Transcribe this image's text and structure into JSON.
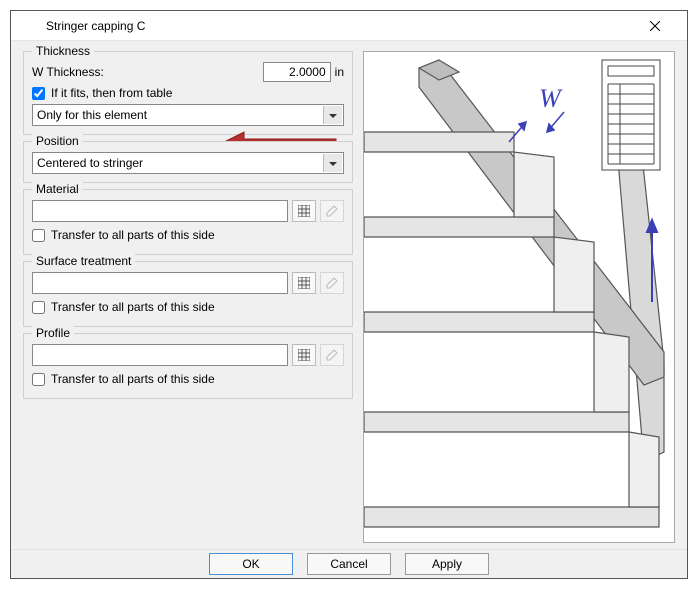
{
  "window": {
    "title": "Stringer capping C"
  },
  "thickness": {
    "legend": "Thickness",
    "w_label": "W Thickness:",
    "w_value": "2.0000",
    "w_unit": "in",
    "fit_checkbox_label": "If it fits, then from table",
    "fit_checked": true,
    "scope_value": "Only for this element"
  },
  "position": {
    "legend": "Position",
    "value": "Centered to stringer"
  },
  "material": {
    "legend": "Material",
    "value": "",
    "transfer_label": "Transfer to all parts of this side",
    "transfer_checked": false
  },
  "surface": {
    "legend": "Surface treatment",
    "value": "",
    "transfer_label": "Transfer to all parts of this side",
    "transfer_checked": false
  },
  "profile": {
    "legend": "Profile",
    "value": "",
    "transfer_label": "Transfer to all parts of this side",
    "transfer_checked": false
  },
  "buttons": {
    "ok": "OK",
    "cancel": "Cancel",
    "apply": "Apply"
  },
  "preview": {
    "dimension_label": "W"
  }
}
